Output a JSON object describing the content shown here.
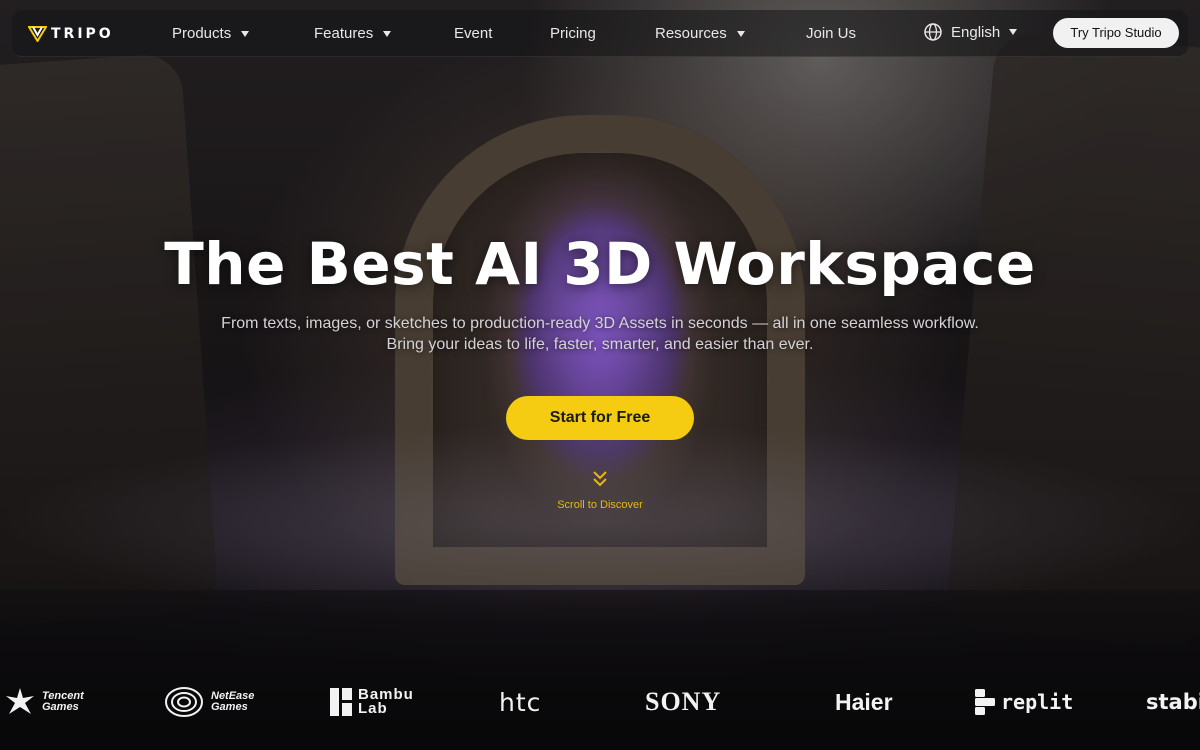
{
  "nav": {
    "logo_text": "TRIPO",
    "items": [
      {
        "label": "Products",
        "has_dropdown": true
      },
      {
        "label": "Features",
        "has_dropdown": true
      },
      {
        "label": "Event",
        "has_dropdown": false
      },
      {
        "label": "Pricing",
        "has_dropdown": false
      },
      {
        "label": "Resources",
        "has_dropdown": true
      },
      {
        "label": "Join Us",
        "has_dropdown": false
      }
    ],
    "language": "English",
    "cta": "Try Tripo Studio"
  },
  "hero": {
    "title": "The Best AI 3D Workspace",
    "subtitle_line1": "From texts, images, or sketches to production-ready 3D Assets in seconds — all in one seamless workflow.",
    "subtitle_line2": "Bring your ideas to life, faster, smarter, and easier than ever.",
    "cta": "Start for Free",
    "scroll_text": "Scroll to Discover"
  },
  "brands": [
    {
      "name": "tencent",
      "line1": "Tencent",
      "line2": "Games"
    },
    {
      "name": "netease",
      "line1": "NetEase",
      "line2": "Games"
    },
    {
      "name": "bambu",
      "line1": "Bambu",
      "line2": "Lab"
    },
    {
      "name": "htc",
      "text": "htc"
    },
    {
      "name": "sony",
      "text": "SONY"
    },
    {
      "name": "haier",
      "text": "Haier"
    },
    {
      "name": "replit",
      "text": "replit"
    },
    {
      "name": "stability",
      "text": "stabi"
    }
  ],
  "colors": {
    "accent": "#f5cc12",
    "scroll_text": "#e6b811",
    "nav_bg": "#141416"
  },
  "icons": {
    "logo": "tripo-v-logo",
    "dropdown": "caret-down-icon",
    "language": "globe-icon",
    "scroll": "double-chevron-down-icon"
  }
}
